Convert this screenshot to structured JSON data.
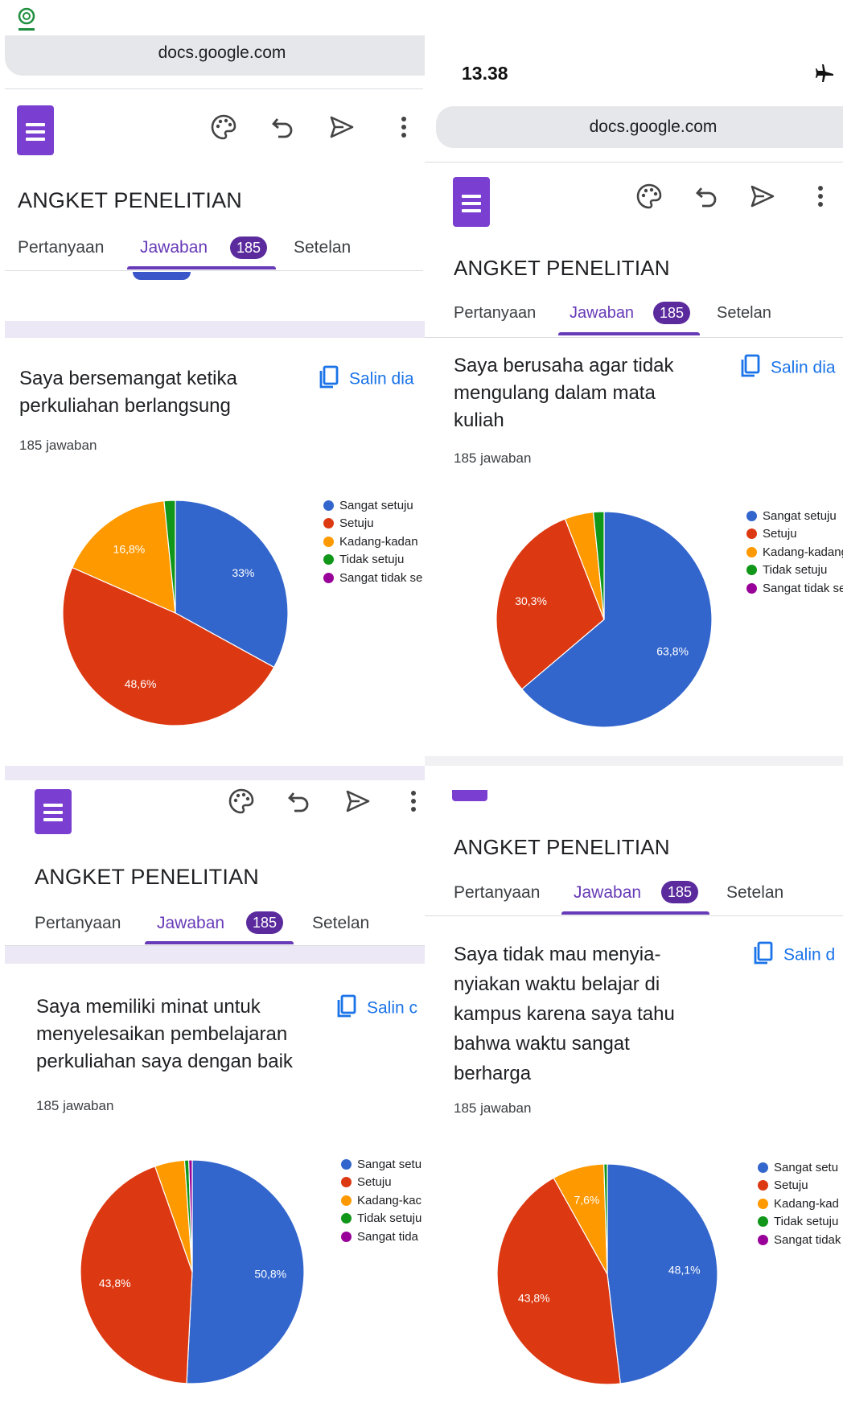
{
  "app_icon": "green-ring-app-icon",
  "status_bar": {
    "time": "13.38",
    "airplane_icon": "airplane-icon"
  },
  "url": "docs.google.com",
  "form_title": "ANGKET PENELITIAN",
  "tabs": {
    "questions": "Pertanyaan",
    "responses": "Jawaban",
    "responses_count": "185",
    "settings": "Setelan"
  },
  "copy_labels": {
    "p1": "Salin dia",
    "p2": "Salin dia",
    "p3": "Salin c",
    "p4": "Salin d"
  },
  "colors": {
    "sangat_setuju": "#3366cc",
    "setuju": "#dc3912",
    "kadang": "#ff9900",
    "tidak_setuju": "#109618",
    "sangat_tidak": "#990099",
    "accent": "#673ab7"
  },
  "legends": {
    "p1": [
      "Sangat setuju",
      "Setuju",
      "Kadang-kadan",
      "Tidak setuju",
      "Sangat tidak se"
    ],
    "p2": [
      "Sangat setuju",
      "Setuju",
      "Kadang-kadang",
      "Tidak setuju",
      "Sangat tidak se"
    ],
    "p3": [
      "Sangat setu",
      "Setuju",
      "Kadang-kac",
      "Tidak setuju",
      "Sangat tida"
    ],
    "p4": [
      "Sangat setu",
      "Setuju",
      "Kadang-kad",
      "Tidak setuju",
      "Sangat tidak"
    ]
  },
  "questions": {
    "p1": {
      "lines": [
        "Saya bersemangat ketika",
        "perkuliahan berlangsung"
      ],
      "count": "185 jawaban"
    },
    "p2": {
      "lines": [
        "Saya berusaha agar tidak",
        "mengulang dalam mata",
        "kuliah"
      ],
      "count": "185 jawaban"
    },
    "p3": {
      "lines": [
        "Saya memiliki minat untuk",
        "menyelesaikan pembelajaran",
        "perkuliahan saya dengan baik"
      ],
      "count": "185 jawaban"
    },
    "p4": {
      "lines": [
        "Saya tidak mau menyia-",
        "nyiakan waktu belajar di",
        "kampus karena saya tahu",
        "bahwa waktu sangat",
        "berharga"
      ],
      "count": "185 jawaban"
    }
  },
  "chart_data": [
    {
      "type": "pie",
      "series": [
        {
          "values": [
            33.0,
            48.6,
            16.8,
            1.6,
            0
          ]
        }
      ],
      "labels": [
        "33%",
        "48,6%",
        "16,8%",
        "",
        ""
      ]
    },
    {
      "type": "pie",
      "series": [
        {
          "values": [
            63.8,
            30.3,
            4.3,
            1.6,
            0
          ]
        }
      ],
      "labels": [
        "63,8%",
        "30,3%",
        "",
        "",
        ""
      ]
    },
    {
      "type": "pie",
      "series": [
        {
          "values": [
            50.8,
            43.8,
            4.3,
            0.6,
            0.5
          ]
        }
      ],
      "labels": [
        "50,8%",
        "43,8%",
        "",
        "",
        ""
      ]
    },
    {
      "type": "pie",
      "series": [
        {
          "values": [
            48.1,
            43.8,
            7.6,
            0.5,
            0
          ]
        }
      ],
      "labels": [
        "48,1%",
        "43,8%",
        "7,6%",
        "",
        ""
      ]
    }
  ]
}
